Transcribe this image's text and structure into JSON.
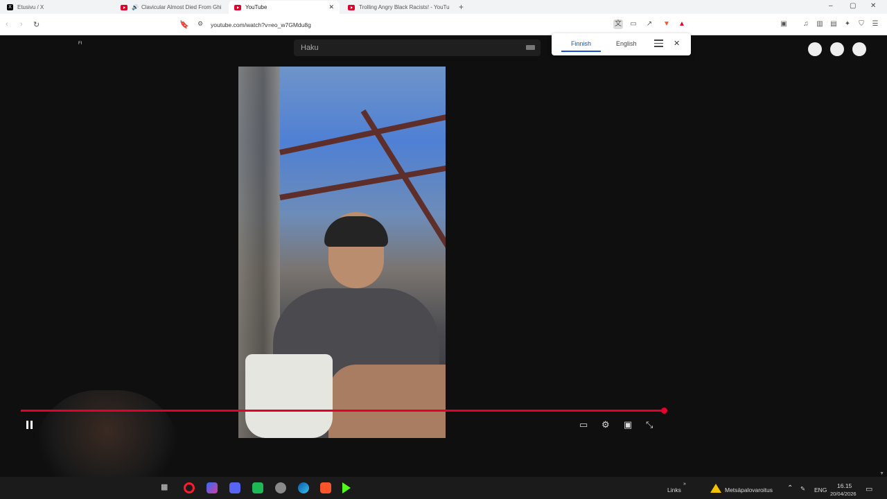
{
  "browser": {
    "tabs": [
      {
        "title": "Etusivu / X",
        "active": false
      },
      {
        "title": "Clavicular Almost Died From Ghi",
        "active": false,
        "audio": true
      },
      {
        "title": "YouTube",
        "active": true
      },
      {
        "title": "Trolling Angry Black Racists! - YouTu",
        "active": false
      }
    ],
    "new_tab": "+",
    "url": "youtube.com/watch?v=eo_w7GMdu8g",
    "minimize": "–",
    "maximize": "▢",
    "close": "✕"
  },
  "translate_bar": {
    "source_lang": "Finnish",
    "target_lang": "English",
    "close": "✕"
  },
  "youtube": {
    "region": "FI",
    "search_placeholder": "Haku"
  },
  "player": {
    "progress": 1.0,
    "accent": "#e4002b"
  },
  "taskbar": {
    "links_label": "Links",
    "links_more": "»",
    "notification": "Metsäpalovaroitus",
    "language": "ENG",
    "time": "16.15",
    "date": "20/04/2026"
  }
}
